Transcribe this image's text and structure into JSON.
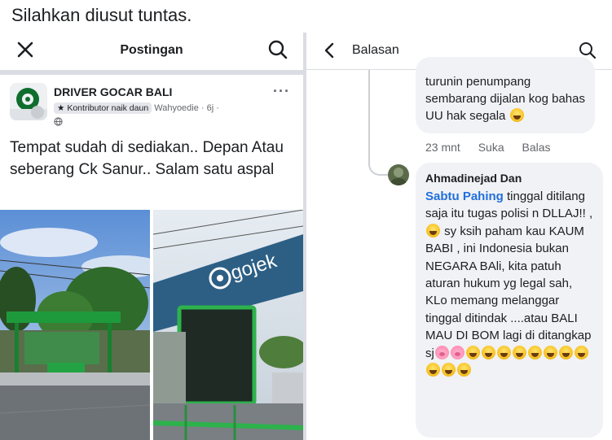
{
  "caption": "Silahkan diusut tuntas.",
  "left": {
    "header_title": "Postingan",
    "post": {
      "group_name": "DRIVER GOCAR BALI",
      "badge": "Kontributor naik daun",
      "author": "Wahyoedie",
      "time": "· 6j ·",
      "more": "···",
      "text": "Tempat sudah di sediakan.. Depan Atau seberang Ck Sanur.. Salam satu aspal",
      "photo_sign_text": "gojek"
    }
  },
  "right": {
    "header_title": "Balasan",
    "reply1": {
      "text": "turunin penumpang sembarang dijalan kog bahas UU hak segala",
      "time": "23 mnt",
      "like_label": "Suka",
      "reply_label": "Balas"
    },
    "reply2": {
      "author": "Ahmadinejad Dan",
      "mention": "Sabtu Pahing",
      "text_a": "tinggal ditilang saja itu tugas polisi n DLLAJ!! ,",
      "text_b": "sy ksih paham kau KAUM BABI , ini Indonesia bukan NEGARA BAli, kita patuh aturan hukum yg legal sah, KLo memang melanggar tinggal ditindak ....atau BALI MAU DI BOM lagi di ditangkap sj"
    }
  },
  "colors": {
    "link": "#216fdb",
    "bubble": "#f0f2f5",
    "muted": "#65676b",
    "gojek_green": "#00aa13"
  }
}
